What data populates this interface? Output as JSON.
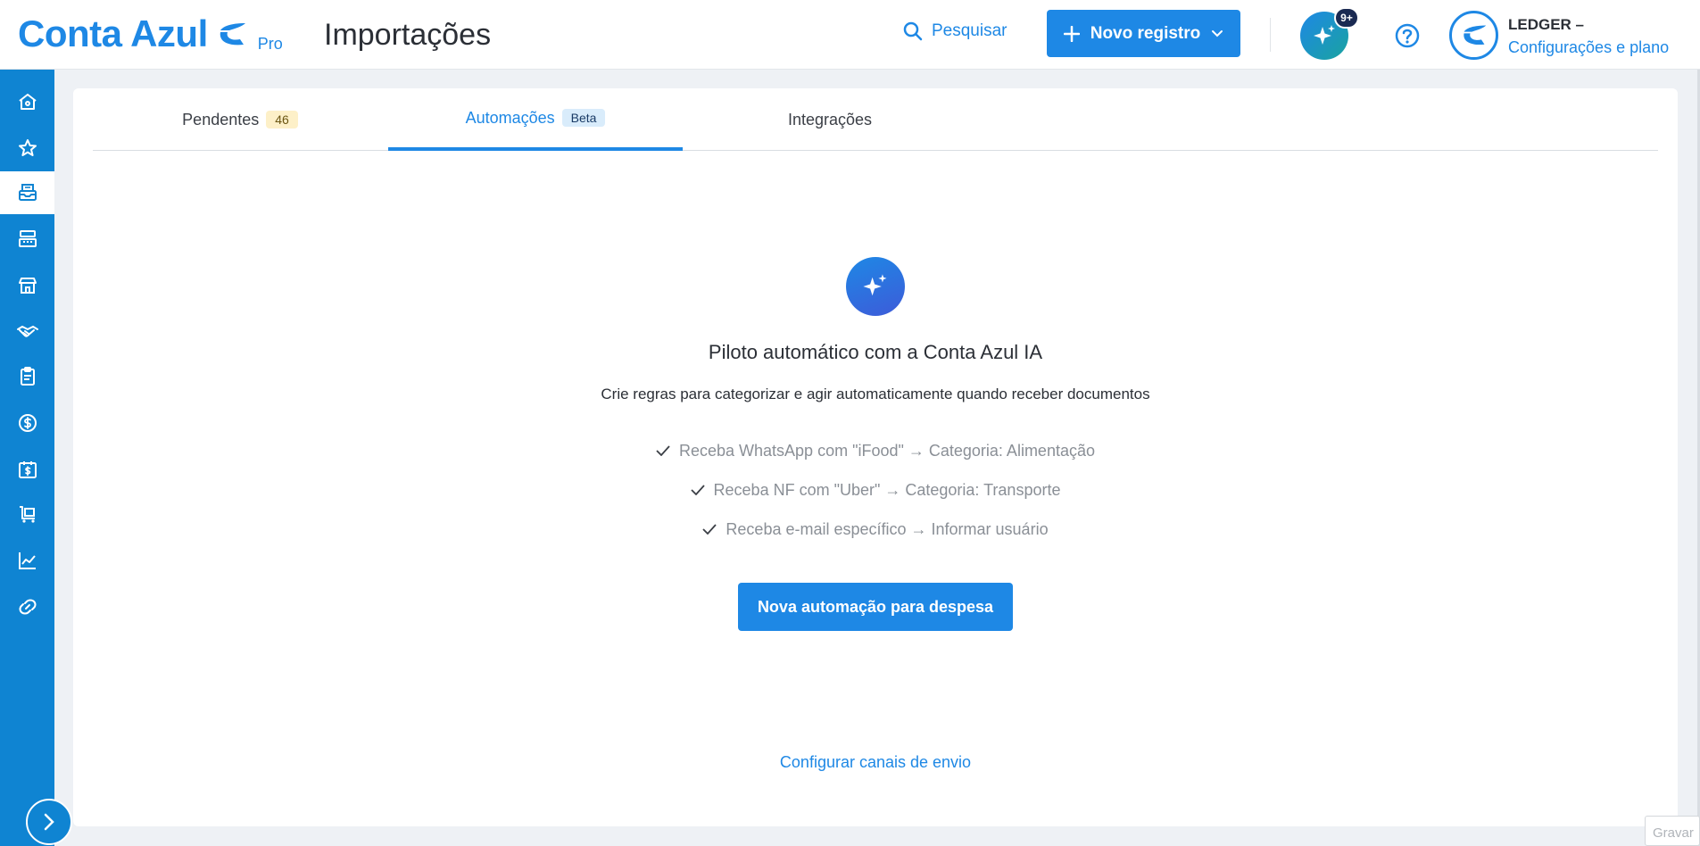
{
  "header": {
    "brand": "Conta Azul",
    "plan": "Pro",
    "page_title": "Importações",
    "search_label": "Pesquisar",
    "new_button_label": "Novo registro",
    "ai_badge": "9+",
    "user_name": "LEDGER –",
    "user_link": "Configurações e plano"
  },
  "sidebar": {
    "items": [
      {
        "icon": "home-icon"
      },
      {
        "icon": "star-icon"
      },
      {
        "icon": "inbox-icon",
        "active": true
      },
      {
        "icon": "cash-register-icon"
      },
      {
        "icon": "store-icon"
      },
      {
        "icon": "handshake-icon"
      },
      {
        "icon": "clipboard-icon"
      },
      {
        "icon": "dollar-circle-icon"
      },
      {
        "icon": "calendar-dollar-icon"
      },
      {
        "icon": "cart-icon"
      },
      {
        "icon": "chart-line-icon"
      },
      {
        "icon": "link-icon"
      }
    ]
  },
  "tabs": [
    {
      "label": "Pendentes",
      "badge": "46",
      "active": false
    },
    {
      "label": "Automações",
      "badge": "Beta",
      "active": true
    },
    {
      "label": "Integrações",
      "badge": "",
      "active": false
    }
  ],
  "empty_state": {
    "title": "Piloto automático com a Conta Azul IA",
    "subtitle": "Crie regras para categorizar e agir automaticamente quando receber documentos",
    "bullets": [
      "Receba WhatsApp com \"iFood\" → Categoria: Alimentação",
      "Receba NF com \"Uber\" → Categoria: Transporte",
      "Receba e-mail específico → Informar usuário"
    ],
    "cta_label": "Nova automação para despesa",
    "config_link": "Configurar canais de envio"
  },
  "overlay_label": "Gravar",
  "colors": {
    "accent": "#1e88e5",
    "sidebar": "#0f84d2",
    "badge_dark": "#1a2a52"
  }
}
